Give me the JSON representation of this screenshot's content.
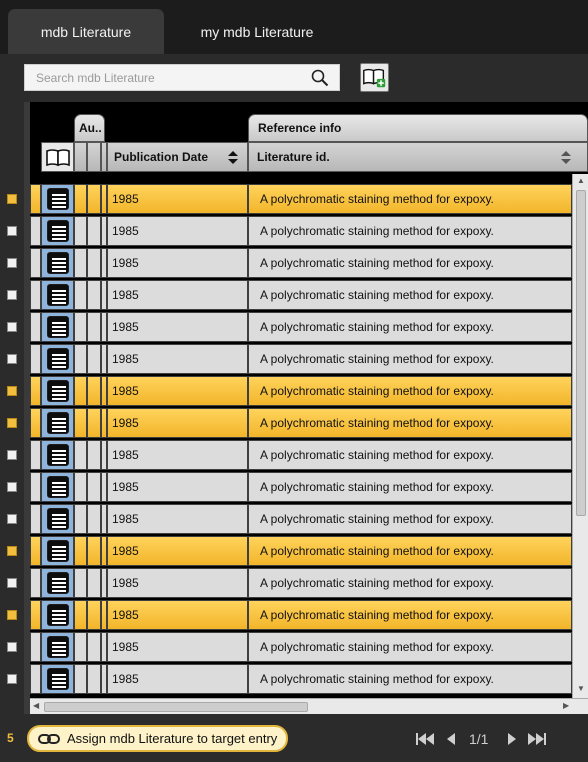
{
  "tabs": [
    {
      "label": "mdb Literature",
      "active": true
    },
    {
      "label": "my mdb Literature",
      "active": false
    }
  ],
  "search": {
    "placeholder": "Search mdb Literature",
    "value": ""
  },
  "table": {
    "group_headers": {
      "authors": "Au..",
      "reference": "Reference info"
    },
    "columns": {
      "publication_date": "Publication Date",
      "literature_id": "Literature id."
    },
    "rows": [
      {
        "date": "1985",
        "title": "A polychromatic staining method for expoxy.",
        "selected": true
      },
      {
        "date": "1985",
        "title": "A polychromatic staining method for expoxy.",
        "selected": false
      },
      {
        "date": "1985",
        "title": "A polychromatic staining method for expoxy.",
        "selected": false
      },
      {
        "date": "1985",
        "title": "A polychromatic staining method for expoxy.",
        "selected": false
      },
      {
        "date": "1985",
        "title": "A polychromatic staining method for expoxy.",
        "selected": false
      },
      {
        "date": "1985",
        "title": "A polychromatic staining method for expoxy.",
        "selected": false
      },
      {
        "date": "1985",
        "title": "A polychromatic staining method for expoxy.",
        "selected": true
      },
      {
        "date": "1985",
        "title": "A polychromatic staining method for expoxy.",
        "selected": true
      },
      {
        "date": "1985",
        "title": "A polychromatic staining method for expoxy.",
        "selected": false
      },
      {
        "date": "1985",
        "title": "A polychromatic staining method for expoxy.",
        "selected": false
      },
      {
        "date": "1985",
        "title": "A polychromatic staining method for expoxy.",
        "selected": false
      },
      {
        "date": "1985",
        "title": "A polychromatic staining method for expoxy.",
        "selected": true
      },
      {
        "date": "1985",
        "title": "A polychromatic staining method for expoxy.",
        "selected": false
      },
      {
        "date": "1985",
        "title": "A polychromatic staining method for expoxy.",
        "selected": true
      },
      {
        "date": "1985",
        "title": "A polychromatic staining method for expoxy.",
        "selected": false
      },
      {
        "date": "1985",
        "title": "A polychromatic staining method for expoxy.",
        "selected": false
      }
    ]
  },
  "footer": {
    "selected_count": "5",
    "assign_label": "Assign mdb Literature to target entry",
    "page_indicator": "1/1"
  },
  "colors": {
    "selected_row": "#f2b52a",
    "accent": "#f1bf3d",
    "icon_cell": "#8fb4dc"
  },
  "icons": {
    "search": "search-icon",
    "add_book": "book-add-icon",
    "book": "book-icon",
    "record": "list-icon",
    "link": "link-icon",
    "first": "first-page-icon",
    "prev": "prev-page-icon",
    "next": "next-page-icon",
    "last": "last-page-icon"
  }
}
